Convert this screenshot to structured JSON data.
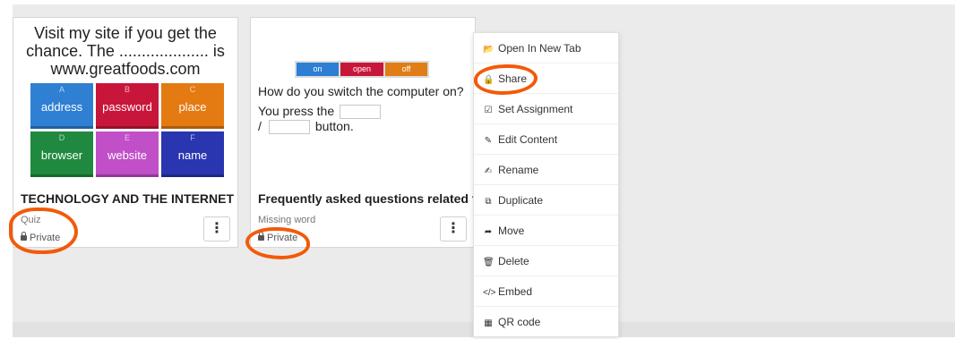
{
  "colors": {
    "accent_annotation": "#f25a0a",
    "tile_blue": "#2f7fd3",
    "tile_red": "#c8163a",
    "tile_orange": "#e47a12",
    "tile_green": "#1f8a3f",
    "tile_purple": "#c04fc8",
    "tile_navy": "#2a35b0"
  },
  "card1": {
    "question": "Visit my site if you get the chance. The .................... is www.greatfoods.com",
    "tiles": [
      {
        "letter": "A",
        "word": "address",
        "color": "#2f7fd3"
      },
      {
        "letter": "B",
        "word": "password",
        "color": "#c8163a"
      },
      {
        "letter": "C",
        "word": "place",
        "color": "#e47a12"
      },
      {
        "letter": "D",
        "word": "browser",
        "color": "#1f8a3f"
      },
      {
        "letter": "E",
        "word": "website",
        "color": "#c04fc8"
      },
      {
        "letter": "F",
        "word": "name",
        "color": "#2a35b0"
      }
    ],
    "title": "TECHNOLOGY AND THE INTERNET",
    "type": "Quiz",
    "privacy": "Private",
    "more_icon": "⋮"
  },
  "card2": {
    "toggle": [
      "on",
      "open",
      "off"
    ],
    "question": "How do you switch the computer on?",
    "line1": "You press the",
    "line2_prefix": "/",
    "line2_suffix": "button.",
    "title": "Frequently asked questions related t",
    "type": "Missing word",
    "privacy": "Private",
    "more_icon": "⋮"
  },
  "menu": {
    "items": [
      {
        "label": "Open In New Tab",
        "icon": "folder-open-icon",
        "glyph": "📂"
      },
      {
        "label": "Share",
        "icon": "lock-icon",
        "glyph": "🔒"
      },
      {
        "label": "Set Assignment",
        "icon": "checkbox-icon",
        "glyph": "☑"
      },
      {
        "label": "Edit Content",
        "icon": "pencil-icon",
        "glyph": "✎"
      },
      {
        "label": "Rename",
        "icon": "edit-box-icon",
        "glyph": "✍"
      },
      {
        "label": "Duplicate",
        "icon": "copy-icon",
        "glyph": "⧉"
      },
      {
        "label": "Move",
        "icon": "move-icon",
        "glyph": "➦"
      },
      {
        "label": "Delete",
        "icon": "trash-icon",
        "glyph": "🗑"
      },
      {
        "label": "Embed",
        "icon": "code-icon",
        "glyph": "</>"
      },
      {
        "label": "QR code",
        "icon": "qrcode-icon",
        "glyph": "▦"
      }
    ]
  }
}
